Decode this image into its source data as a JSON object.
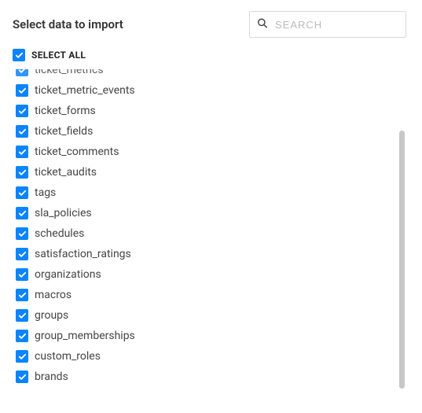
{
  "header": {
    "title": "Select data to import",
    "search_placeholder": "SEARCH"
  },
  "select_all": {
    "label": "SELECT ALL",
    "checked": true
  },
  "items": [
    {
      "label": "ticket_metrics",
      "checked": true
    },
    {
      "label": "ticket_metric_events",
      "checked": true
    },
    {
      "label": "ticket_forms",
      "checked": true
    },
    {
      "label": "ticket_fields",
      "checked": true
    },
    {
      "label": "ticket_comments",
      "checked": true
    },
    {
      "label": "ticket_audits",
      "checked": true
    },
    {
      "label": "tags",
      "checked": true
    },
    {
      "label": "sla_policies",
      "checked": true
    },
    {
      "label": "schedules",
      "checked": true
    },
    {
      "label": "satisfaction_ratings",
      "checked": true
    },
    {
      "label": "organizations",
      "checked": true
    },
    {
      "label": "macros",
      "checked": true
    },
    {
      "label": "groups",
      "checked": true
    },
    {
      "label": "group_memberships",
      "checked": true
    },
    {
      "label": "custom_roles",
      "checked": true
    },
    {
      "label": "brands",
      "checked": true
    }
  ]
}
